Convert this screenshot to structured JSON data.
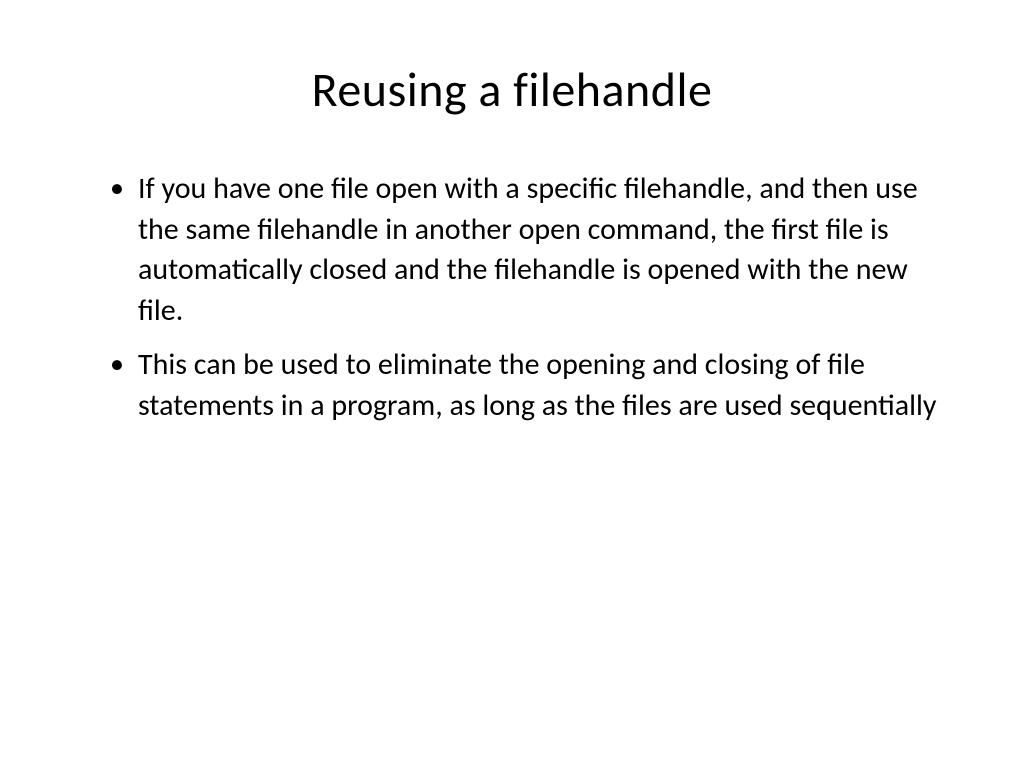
{
  "slide": {
    "title": "Reusing a filehandle",
    "bullets": [
      "If you have one file open with a specific filehandle, and then use the same filehandle in another open command, the first file is automatically closed and the filehandle is opened with the new file.",
      "This can be used to eliminate the opening and closing of file statements in a program, as long as the files are used sequentially"
    ]
  }
}
